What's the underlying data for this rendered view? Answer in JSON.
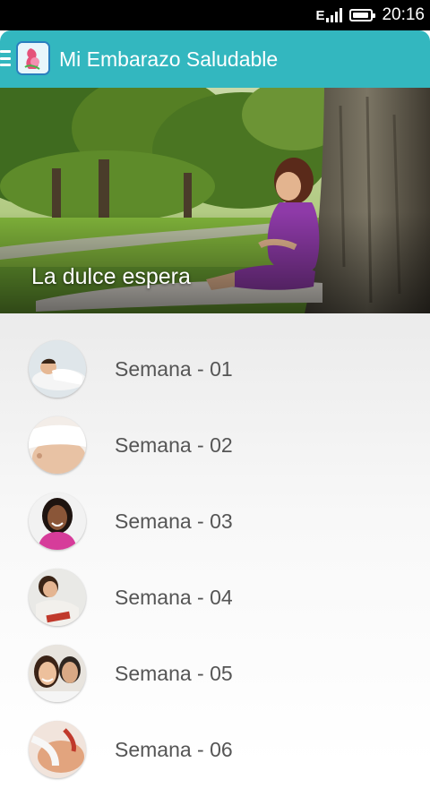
{
  "status_bar": {
    "network": "E",
    "time": "20:16"
  },
  "app_bar": {
    "title": "Mi Embarazo Saludable",
    "menu_icon": "hamburger-icon",
    "logo_icon": "pregnancy-logo-icon"
  },
  "hero": {
    "caption": "La dulce espera"
  },
  "weeks": [
    {
      "label": "Semana - 01"
    },
    {
      "label": "Semana - 02"
    },
    {
      "label": "Semana - 03"
    },
    {
      "label": "Semana - 04"
    },
    {
      "label": "Semana - 05"
    },
    {
      "label": "Semana - 06"
    }
  ],
  "colors": {
    "app_bar": "#33b7bf",
    "status_bar": "#000000",
    "list_text": "#555555"
  }
}
